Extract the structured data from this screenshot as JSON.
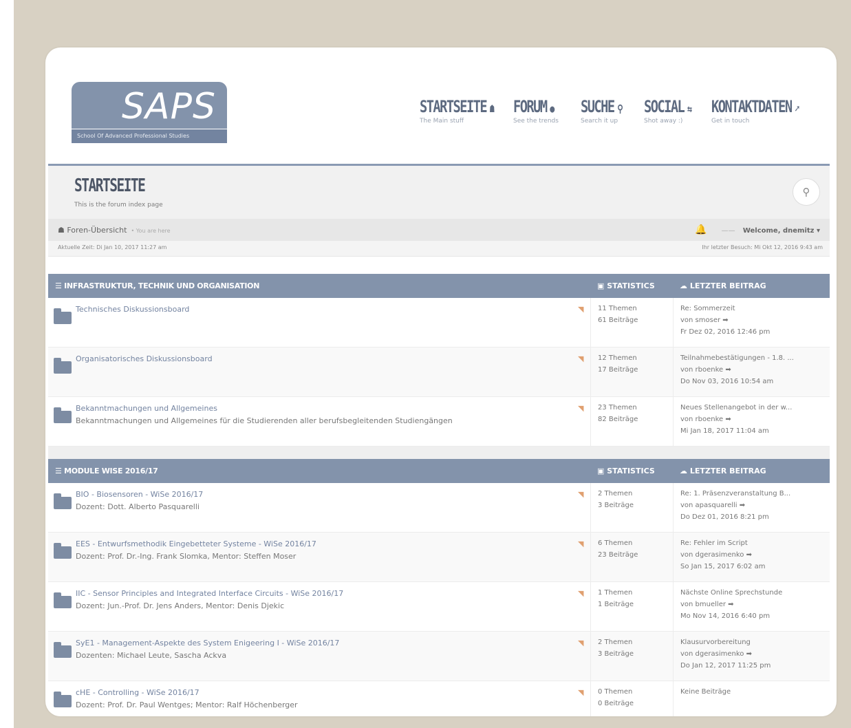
{
  "logo": {
    "text": "SAPS",
    "subtitle": "School Of Advanced Professional Studies"
  },
  "nav": [
    {
      "label": "STARTSEITE",
      "icon": "home-icon",
      "glyph": "☗",
      "sub": "The Main stuff"
    },
    {
      "label": "FORUM",
      "icon": "chat-icon",
      "glyph": "●",
      "sub": "See the trends"
    },
    {
      "label": "SUCHE",
      "icon": "search-icon",
      "glyph": "⚲",
      "sub": "Search it up"
    },
    {
      "label": "SOCIAL",
      "icon": "retweet-icon",
      "glyph": "⇆",
      "sub": "Shot away :)"
    },
    {
      "label": "KONTAKTDATEN",
      "icon": "rocket-icon",
      "glyph": "➚",
      "sub": "Get in touch"
    }
  ],
  "page": {
    "title": "STARTSEITE",
    "subtitle": "This is the forum index page"
  },
  "breadcrumb": {
    "home": "Foren-Übersicht",
    "you_are_here": "• You are here"
  },
  "user": {
    "welcome": "Welcome, dnemitz ▾",
    "dash": "——"
  },
  "times": {
    "current": "Aktuelle Zeit: Di Jan 10, 2017 11:27 am",
    "last_visit": "Ihr letzter Besuch: Mi Okt 12, 2016 9:43 am"
  },
  "sections": [
    {
      "title": "INFRASTRUKTUR, TECHNIK UND ORGANISATION",
      "stat_label": "STATISTICS",
      "last_label": "LETZTER BEITRAG",
      "rows": [
        {
          "name": "Technisches Diskussionsboard",
          "desc": "",
          "topics": "11 Themen",
          "posts": "61 Beiträge",
          "last1": "Re: Sommerzeit",
          "last2": "von smoser ➡",
          "last3": "Fr Dez 02, 2016 12:46 pm"
        },
        {
          "name": "Organisatorisches Diskussionsboard",
          "desc": "",
          "topics": "12 Themen",
          "posts": "17 Beiträge",
          "last1": "Teilnahmebestätigungen - 1.8. ...",
          "last2": "von rboenke ➡",
          "last3": "Do Nov 03, 2016 10:54 am"
        },
        {
          "name": "Bekanntmachungen und Allgemeines",
          "desc": "Bekanntmachungen und Allgemeines für die Studierenden aller berufsbegleitenden Studiengängen",
          "topics": "23 Themen",
          "posts": "82 Beiträge",
          "last1": "Neues Stellenangebot in der w...",
          "last2": "von rboenke ➡",
          "last3": "Mi Jan 18, 2017 11:04 am"
        }
      ]
    },
    {
      "title": "MODULE WISE 2016/17",
      "stat_label": "STATISTICS",
      "last_label": "LETZTER BEITRAG",
      "rows": [
        {
          "name": "BIO - Biosensoren - WiSe 2016/17",
          "desc": "Dozent: Dott. Alberto Pasquarelli",
          "topics": "2 Themen",
          "posts": "3 Beiträge",
          "last1": "Re: 1. Präsenzveranstaltung B...",
          "last2": "von apasquarelli ➡",
          "last3": "Do Dez 01, 2016 8:21 pm"
        },
        {
          "name": "EES - Entwurfsmethodik Eingebetteter Systeme - WiSe 2016/17",
          "desc": "Dozent: Prof. Dr.-Ing. Frank Slomka, Mentor: Steffen Moser",
          "topics": "6 Themen",
          "posts": "23 Beiträge",
          "last1": "Re: Fehler im Script",
          "last2": "von dgerasimenko ➡",
          "last3": "So Jan 15, 2017 6:02 am"
        },
        {
          "name": "IIC - Sensor Principles and Integrated Interface Circuits - WiSe 2016/17",
          "desc": "Dozent: Jun.-Prof. Dr. Jens Anders, Mentor: Denis Djekic",
          "topics": "1 Themen",
          "posts": "1 Beiträge",
          "last1": "Nächste Online Sprechstunde",
          "last2": "von bmueller ➡",
          "last3": "Mo Nov 14, 2016 6:40 pm"
        },
        {
          "name": "SyE1 - Management-Aspekte des System Enigeering I - WiSe 2016/17",
          "desc": "Dozenten: Michael Leute, Sascha Ackva",
          "topics": "2 Themen",
          "posts": "3 Beiträge",
          "last1": "Klausurvorbereitung",
          "last2": "von dgerasimenko ➡",
          "last3": "Do Jan 12, 2017 11:25 pm"
        },
        {
          "name": "cHE - Controlling - WiSe 2016/17",
          "desc": "Dozent: Prof. Dr. Paul Wentges; Mentor: Ralf Höchenberger",
          "topics": "0 Themen",
          "posts": "0 Beiträge",
          "last1": "Keine Beiträge",
          "last2": "",
          "last3": ""
        }
      ]
    }
  ]
}
